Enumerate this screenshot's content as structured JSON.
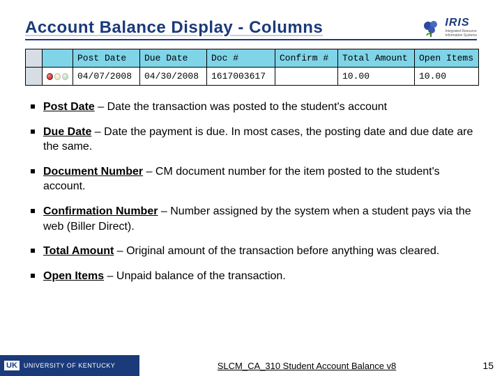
{
  "title": "Account Balance Display - Columns",
  "logo": {
    "text": "IRIS",
    "sub1": "Integrated Resource",
    "sub2": "Information Systems"
  },
  "table": {
    "headers": {
      "post_date": "Post Date",
      "due_date": "Due Date",
      "doc": "Doc #",
      "confirm": "Confirm #",
      "total": "Total Amount",
      "open": "Open Items"
    },
    "row": {
      "post_date": "04/07/2008",
      "due_date": "04/30/2008",
      "doc": "1617003617",
      "confirm": "",
      "total": "10.00",
      "open": "10.00"
    }
  },
  "bullets": [
    {
      "term": "Post Date",
      "desc": " – Date the transaction was posted to the student's account"
    },
    {
      "term": "Due Date",
      "desc": " – Date the payment is due.  In most cases, the posting date and due date are the same."
    },
    {
      "term": "Document Number",
      "desc": " – CM document number for the item posted to the student's account."
    },
    {
      "term": "Confirmation Number",
      "desc": " – Number assigned by the system when a student pays via the web (Biller Direct)."
    },
    {
      "term": "Total Amount",
      "desc": " – Original amount of the transaction before anything was cleared."
    },
    {
      "term": "Open Items",
      "desc": " – Unpaid balance of the transaction."
    }
  ],
  "footer": {
    "uk_badge": "UK",
    "uk_text": "UNIVERSITY OF KENTUCKY",
    "center": "SLCM_CA_310 Student Account Balance v8",
    "page": "15"
  }
}
